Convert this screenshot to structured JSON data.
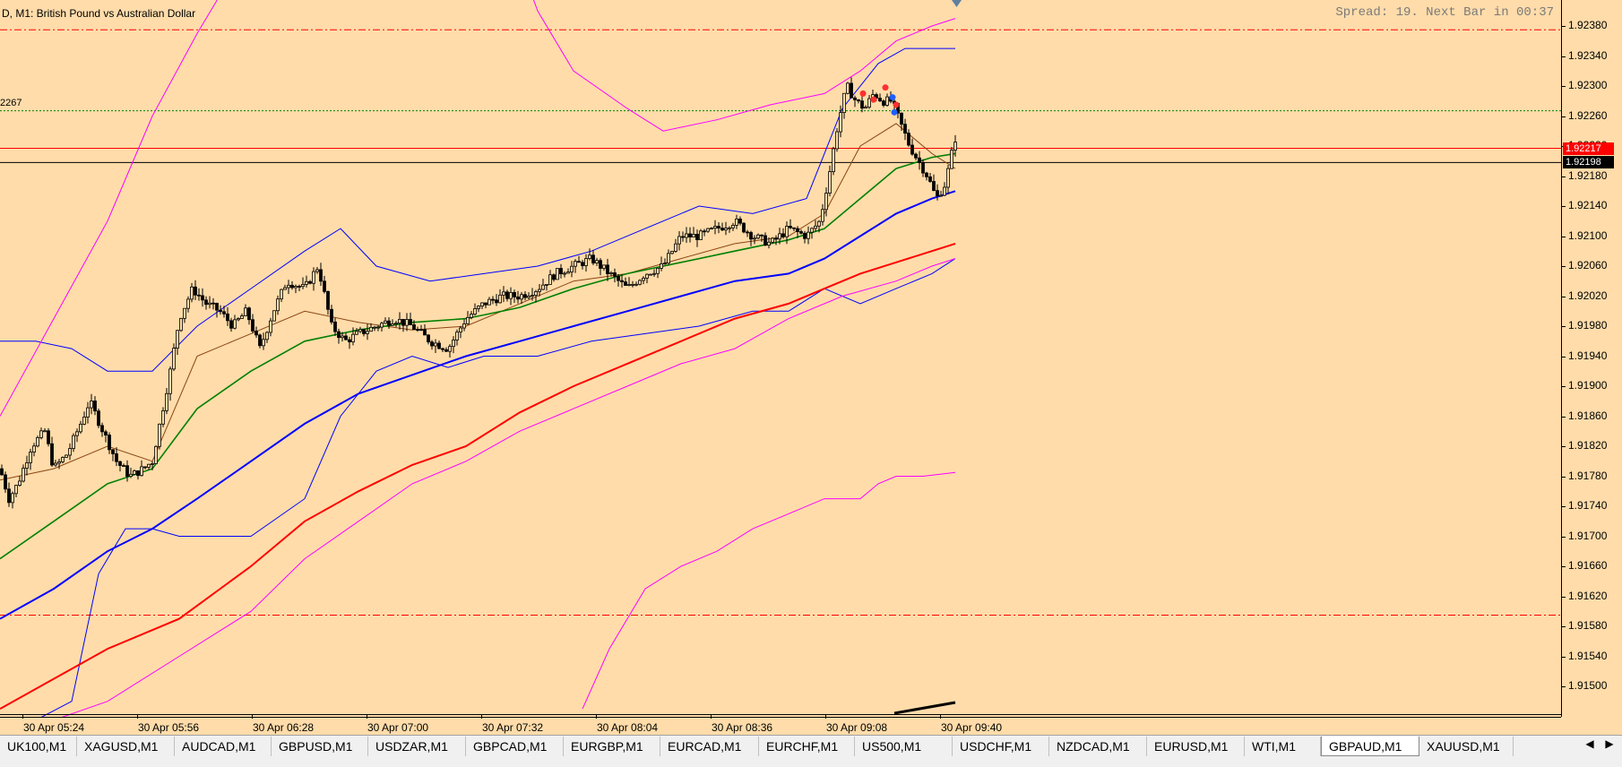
{
  "chart": {
    "title": "D, M1:  British Pound vs Australian Dollar",
    "spread_text": "Spread: 19. Next Bar in 00:37",
    "level_label": "2267",
    "bid_badge": "1.92217",
    "ask_badge": "1.92198",
    "colors": {
      "background": "#ffdcaa",
      "candle": "#000000",
      "ma_fast": "#8b4513",
      "ma_green": "#008000",
      "ma_blue": "#0000ff",
      "ma_red": "#ff0000",
      "bands_blue": "#0000ff",
      "bands_magenta": "#ff00ff",
      "bid_line": "#ff0000",
      "ask_line": "#000000"
    }
  },
  "chart_data": {
    "type": "line",
    "title": "British Pound vs Australian Dollar",
    "symbol": "GBPAUD",
    "timeframe": "M1",
    "y_ticks": [
      "1.92380",
      "1.92340",
      "1.92300",
      "1.92260",
      "1.92220",
      "1.92180",
      "1.92140",
      "1.92100",
      "1.92060",
      "1.92020",
      "1.91980",
      "1.91940",
      "1.91900",
      "1.91860",
      "1.91820",
      "1.91780",
      "1.91740",
      "1.91700",
      "1.91660",
      "1.91620",
      "1.91580",
      "1.91540",
      "1.91500"
    ],
    "x_ticks": [
      "30 Apr 05:24",
      "30 Apr 05:56",
      "30 Apr 06:28",
      "30 Apr 07:00",
      "30 Apr 07:32",
      "30 Apr 08:04",
      "30 Apr 08:36",
      "30 Apr 09:08",
      "30 Apr 09:40"
    ],
    "ylim": [
      1.9146,
      1.9239
    ],
    "horizontal_levels": [
      {
        "value": 1.92375,
        "style": "dashdot",
        "color": "#ff0000"
      },
      {
        "value": 1.92267,
        "style": "dotted",
        "color": "#008000"
      },
      {
        "value": 1.92217,
        "style": "solid",
        "color": "#ff0000"
      },
      {
        "value": 1.92198,
        "style": "solid",
        "color": "#000000"
      },
      {
        "value": 1.91595,
        "style": "dashdot",
        "color": "#ff0000"
      }
    ],
    "price_path": [
      [
        0,
        1.9179
      ],
      [
        10,
        1.9175
      ],
      [
        20,
        1.9177
      ],
      [
        35,
        1.9182
      ],
      [
        50,
        1.9184
      ],
      [
        60,
        1.9179
      ],
      [
        75,
        1.9181
      ],
      [
        90,
        1.9185
      ],
      [
        100,
        1.9188
      ],
      [
        115,
        1.9184
      ],
      [
        130,
        1.918
      ],
      [
        145,
        1.9178
      ],
      [
        160,
        1.9179
      ],
      [
        170,
        1.918
      ],
      [
        180,
        1.9186
      ],
      [
        190,
        1.9192
      ],
      [
        200,
        1.9199
      ],
      [
        215,
        1.9203
      ],
      [
        230,
        1.9201
      ],
      [
        245,
        1.92
      ],
      [
        260,
        1.9198
      ],
      [
        275,
        1.92
      ],
      [
        290,
        1.9195
      ],
      [
        305,
        1.92
      ],
      [
        320,
        1.9204
      ],
      [
        340,
        1.9203
      ],
      [
        355,
        1.9206
      ],
      [
        370,
        1.9198
      ],
      [
        385,
        1.9196
      ],
      [
        400,
        1.9197
      ],
      [
        420,
        1.9198
      ],
      [
        440,
        1.9199
      ],
      [
        460,
        1.9198
      ],
      [
        480,
        1.9196
      ],
      [
        500,
        1.9195
      ],
      [
        520,
        1.9199
      ],
      [
        540,
        1.9201
      ],
      [
        560,
        1.9202
      ],
      [
        580,
        1.9202
      ],
      [
        600,
        1.9203
      ],
      [
        620,
        1.9205
      ],
      [
        640,
        1.9206
      ],
      [
        660,
        1.9207
      ],
      [
        680,
        1.9205
      ],
      [
        700,
        1.9203
      ],
      [
        720,
        1.9205
      ],
      [
        740,
        1.9206
      ],
      [
        760,
        1.921
      ],
      [
        780,
        1.921
      ],
      [
        800,
        1.9211
      ],
      [
        820,
        1.9212
      ],
      [
        840,
        1.921
      ],
      [
        860,
        1.9209
      ],
      [
        880,
        1.9211
      ],
      [
        900,
        1.921
      ],
      [
        915,
        1.9212
      ],
      [
        925,
        1.9218
      ],
      [
        935,
        1.9225
      ],
      [
        945,
        1.923
      ],
      [
        955,
        1.9228
      ],
      [
        965,
        1.9227
      ],
      [
        975,
        1.9229
      ],
      [
        985,
        1.9228
      ],
      [
        995,
        1.9228
      ],
      [
        1005,
        1.9225
      ],
      [
        1015,
        1.9222
      ],
      [
        1025,
        1.922
      ],
      [
        1035,
        1.9218
      ],
      [
        1045,
        1.9215
      ],
      [
        1055,
        1.9217
      ],
      [
        1062,
        1.9221
      ],
      [
        1066,
        1.9223
      ]
    ],
    "series": [
      {
        "color": "#8b4513",
        "values": [
          [
            0,
            1.91775
          ],
          [
            60,
            1.9179
          ],
          [
            120,
            1.9182
          ],
          [
            170,
            1.918
          ],
          [
            220,
            1.9194
          ],
          [
            280,
            1.9197
          ],
          [
            340,
            1.92
          ],
          [
            400,
            1.91985
          ],
          [
            460,
            1.91975
          ],
          [
            520,
            1.9198
          ],
          [
            580,
            1.9201
          ],
          [
            640,
            1.9204
          ],
          [
            700,
            1.9205
          ],
          [
            760,
            1.9207
          ],
          [
            820,
            1.9209
          ],
          [
            880,
            1.921
          ],
          [
            920,
            1.9213
          ],
          [
            960,
            1.9222
          ],
          [
            1000,
            1.9225
          ],
          [
            1040,
            1.9221
          ],
          [
            1066,
            1.9219
          ]
        ]
      },
      {
        "color": "#008000",
        "values": [
          [
            0,
            1.9167
          ],
          [
            60,
            1.9172
          ],
          [
            120,
            1.9177
          ],
          [
            170,
            1.9179
          ],
          [
            220,
            1.9187
          ],
          [
            280,
            1.9192
          ],
          [
            340,
            1.9196
          ],
          [
            400,
            1.91975
          ],
          [
            460,
            1.91985
          ],
          [
            520,
            1.9199
          ],
          [
            580,
            1.92005
          ],
          [
            640,
            1.9203
          ],
          [
            700,
            1.9205
          ],
          [
            760,
            1.92065
          ],
          [
            820,
            1.9208
          ],
          [
            880,
            1.92095
          ],
          [
            920,
            1.9211
          ],
          [
            960,
            1.9215
          ],
          [
            1000,
            1.9219
          ],
          [
            1040,
            1.92205
          ],
          [
            1066,
            1.9221
          ]
        ]
      },
      {
        "color": "#0000ff",
        "values": [
          [
            0,
            1.9159
          ],
          [
            60,
            1.9163
          ],
          [
            120,
            1.9168
          ],
          [
            170,
            1.9171
          ],
          [
            220,
            1.9175
          ],
          [
            280,
            1.918
          ],
          [
            340,
            1.9185
          ],
          [
            400,
            1.9189
          ],
          [
            460,
            1.91915
          ],
          [
            520,
            1.9194
          ],
          [
            580,
            1.9196
          ],
          [
            640,
            1.9198
          ],
          [
            700,
            1.92
          ],
          [
            760,
            1.9202
          ],
          [
            820,
            1.9204
          ],
          [
            880,
            1.9205
          ],
          [
            920,
            1.9207
          ],
          [
            960,
            1.921
          ],
          [
            1000,
            1.9213
          ],
          [
            1040,
            1.9215
          ],
          [
            1066,
            1.9216
          ]
        ]
      },
      {
        "color": "#ff0000",
        "values": [
          [
            0,
            1.9147
          ],
          [
            60,
            1.9151
          ],
          [
            120,
            1.9155
          ],
          [
            200,
            1.9159
          ],
          [
            280,
            1.9166
          ],
          [
            340,
            1.9172
          ],
          [
            400,
            1.9176
          ],
          [
            460,
            1.91795
          ],
          [
            520,
            1.9182
          ],
          [
            580,
            1.91865
          ],
          [
            640,
            1.919
          ],
          [
            700,
            1.9193
          ],
          [
            760,
            1.9196
          ],
          [
            820,
            1.9199
          ],
          [
            880,
            1.9201
          ],
          [
            920,
            1.9203
          ],
          [
            960,
            1.9205
          ],
          [
            1000,
            1.92065
          ],
          [
            1040,
            1.9208
          ],
          [
            1066,
            1.9209
          ]
        ]
      }
    ],
    "bands": [
      {
        "color": "#0000ff",
        "upper": [
          [
            0,
            1.9196
          ],
          [
            40,
            1.9196
          ],
          [
            80,
            1.9195
          ],
          [
            120,
            1.9192
          ],
          [
            170,
            1.9192
          ],
          [
            220,
            1.9198
          ],
          [
            280,
            1.9203
          ],
          [
            340,
            1.9208
          ],
          [
            380,
            1.9211
          ],
          [
            420,
            1.9206
          ],
          [
            480,
            1.9204
          ],
          [
            540,
            1.9205
          ],
          [
            600,
            1.9206
          ],
          [
            660,
            1.9208
          ],
          [
            720,
            1.9211
          ],
          [
            780,
            1.9214
          ],
          [
            840,
            1.9213
          ],
          [
            900,
            1.9215
          ],
          [
            940,
            1.9227
          ],
          [
            980,
            1.9233
          ],
          [
            1010,
            1.9235
          ],
          [
            1040,
            1.9235
          ],
          [
            1066,
            1.9235
          ]
        ],
        "lower": [
          [
            0,
            1.9143
          ],
          [
            80,
            1.9148
          ],
          [
            110,
            1.9165
          ],
          [
            140,
            1.9171
          ],
          [
            170,
            1.9171
          ],
          [
            200,
            1.917
          ],
          [
            240,
            1.917
          ],
          [
            280,
            1.917
          ],
          [
            340,
            1.9175
          ],
          [
            380,
            1.9186
          ],
          [
            420,
            1.9192
          ],
          [
            460,
            1.9194
          ],
          [
            500,
            1.91925
          ],
          [
            540,
            1.9194
          ],
          [
            600,
            1.9194
          ],
          [
            660,
            1.9196
          ],
          [
            720,
            1.9197
          ],
          [
            780,
            1.9198
          ],
          [
            840,
            1.92
          ],
          [
            880,
            1.92
          ],
          [
            920,
            1.9203
          ],
          [
            960,
            1.9201
          ],
          [
            1000,
            1.9203
          ],
          [
            1040,
            1.9205
          ],
          [
            1066,
            1.9207
          ]
        ]
      },
      {
        "color": "#ff00ff",
        "upper": [
          [
            0,
            1.9186
          ],
          [
            60,
            1.9199
          ],
          [
            120,
            1.9212
          ],
          [
            170,
            1.9226
          ],
          [
            220,
            1.9237
          ],
          [
            280,
            1.9249
          ],
          [
            340,
            1.9256
          ],
          [
            400,
            1.9258
          ],
          [
            460,
            1.9258
          ],
          [
            560,
            1.9253
          ],
          [
            600,
            1.924
          ],
          [
            640,
            1.9232
          ],
          [
            700,
            1.9227
          ],
          [
            740,
            1.9224
          ],
          [
            800,
            1.92255
          ],
          [
            860,
            1.92275
          ],
          [
            920,
            1.9229
          ],
          [
            960,
            1.9232
          ],
          [
            1000,
            1.9236
          ],
          [
            1040,
            1.9238
          ],
          [
            1066,
            1.9239
          ]
        ],
        "lower": [
          [
            0,
            1.9143
          ],
          [
            120,
            1.9148
          ],
          [
            200,
            1.9154
          ],
          [
            280,
            1.916
          ],
          [
            340,
            1.9167
          ],
          [
            400,
            1.9172
          ],
          [
            460,
            1.9177
          ],
          [
            520,
            1.918
          ],
          [
            580,
            1.9184
          ],
          [
            640,
            1.9187
          ],
          [
            700,
            1.919
          ],
          [
            760,
            1.9193
          ],
          [
            820,
            1.9195
          ],
          [
            880,
            1.9199
          ],
          [
            940,
            1.9202
          ],
          [
            1000,
            1.9204
          ],
          [
            1040,
            1.9206
          ],
          [
            1066,
            1.9207
          ]
        ]
      },
      {
        "color": "#ff00ff",
        "upper": [],
        "lower": [
          [
            650,
            1.9147
          ],
          [
            680,
            1.9155
          ],
          [
            720,
            1.9163
          ],
          [
            760,
            1.9166
          ],
          [
            800,
            1.9168
          ],
          [
            840,
            1.9171
          ],
          [
            880,
            1.9173
          ],
          [
            920,
            1.9175
          ],
          [
            960,
            1.9175
          ],
          [
            980,
            1.9177
          ],
          [
            1000,
            1.9178
          ],
          [
            1030,
            1.9178
          ],
          [
            1066,
            1.91785
          ]
        ]
      }
    ]
  },
  "tabs": {
    "items": [
      {
        "label": "UK100,M1",
        "active": false
      },
      {
        "label": "XAGUSD,M1",
        "active": false
      },
      {
        "label": "AUDCAD,M1",
        "active": false
      },
      {
        "label": "GBPUSD,M1",
        "active": false
      },
      {
        "label": "USDZAR,M1",
        "active": false
      },
      {
        "label": "GBPCAD,M1",
        "active": false
      },
      {
        "label": "EURGBP,M1",
        "active": false
      },
      {
        "label": "EURCAD,M1",
        "active": false
      },
      {
        "label": "EURCHF,M1",
        "active": false
      },
      {
        "label": "US500,M1",
        "active": false
      },
      {
        "label": "USDCHF,M1",
        "active": false
      },
      {
        "label": "NZDCAD,M1",
        "active": false
      },
      {
        "label": "EURUSD,M1",
        "active": false
      },
      {
        "label": "WTI,M1",
        "active": false
      },
      {
        "label": "GBPAUD,M1",
        "active": true
      },
      {
        "label": "XAUUSD,M1",
        "active": false
      }
    ],
    "scroll_left_icon": "triangle-left-icon",
    "scroll_right_icon": "triangle-right-icon",
    "scroll_left_glyph": "◀",
    "scroll_right_glyph": "▶"
  }
}
